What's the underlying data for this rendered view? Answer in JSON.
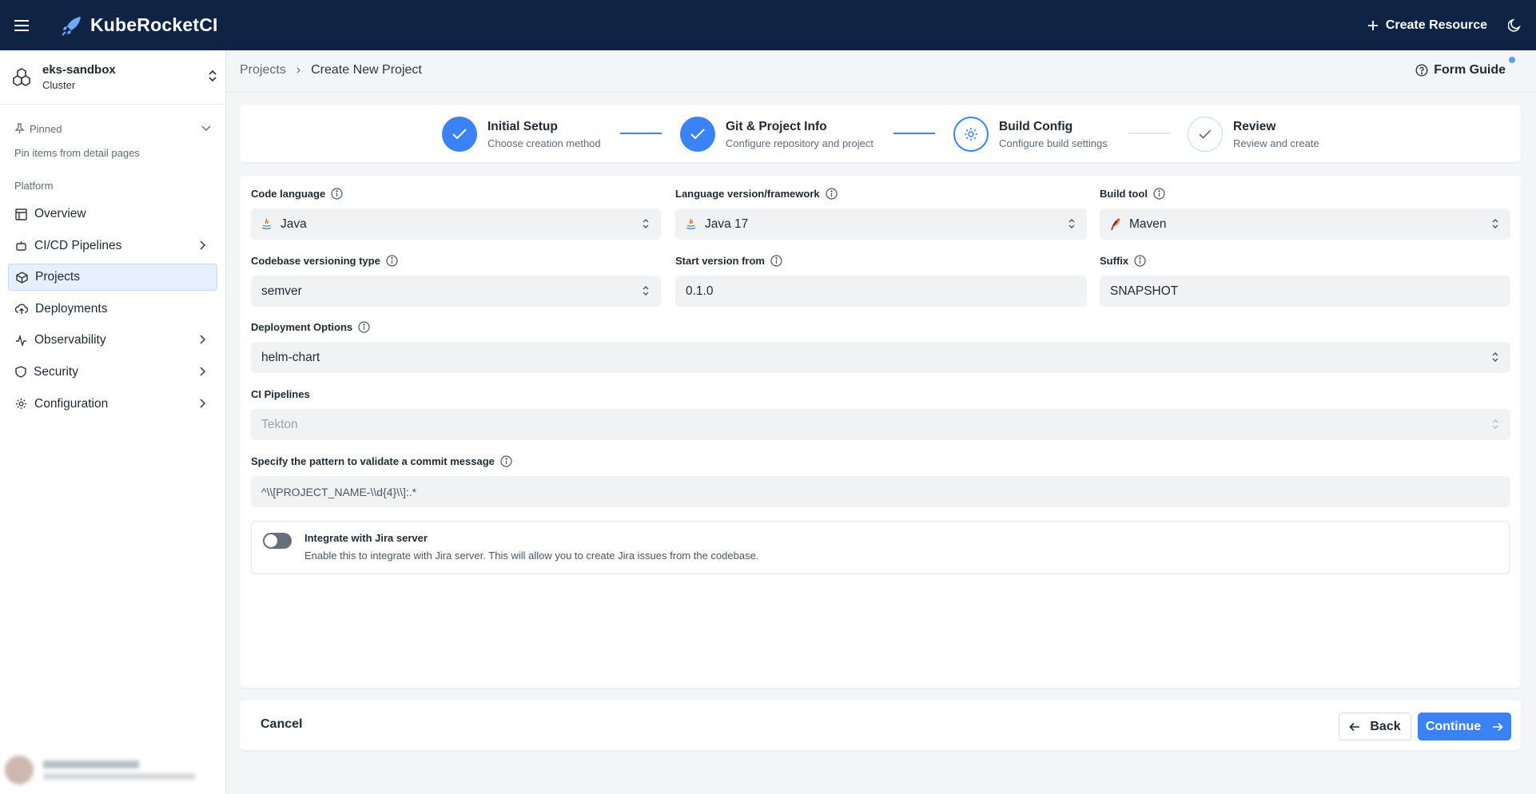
{
  "app": {
    "title": "KubeRocketCI",
    "create_resource": "Create Resource"
  },
  "cluster": {
    "name": "eks-sandbox",
    "type": "Cluster"
  },
  "sidebar": {
    "pinned_label": "Pinned",
    "pinned_hint": "Pin items from detail pages",
    "section_label": "Platform",
    "items": [
      {
        "label": "Overview",
        "icon": "table-icon"
      },
      {
        "label": "CI/CD Pipelines",
        "icon": "robot-icon"
      },
      {
        "label": "Projects",
        "icon": "box-icon",
        "active": true
      },
      {
        "label": "Deployments",
        "icon": "cloud-upload-icon"
      },
      {
        "label": "Observability",
        "icon": "activity-icon"
      },
      {
        "label": "Security",
        "icon": "shield-icon"
      },
      {
        "label": "Configuration",
        "icon": "gear-icon"
      }
    ]
  },
  "breadcrumb": {
    "parent": "Projects",
    "separator": "›",
    "current": "Create New Project"
  },
  "form_guide": "Form Guide",
  "stepper": [
    {
      "title": "Initial Setup",
      "desc": "Choose creation method",
      "state": "done"
    },
    {
      "title": "Git & Project Info",
      "desc": "Configure repository and project",
      "state": "done"
    },
    {
      "title": "Build Config",
      "desc": "Configure build settings",
      "state": "current"
    },
    {
      "title": "Review",
      "desc": "Review and create",
      "state": "todo"
    }
  ],
  "form": {
    "code_language": {
      "label": "Code language",
      "value": "Java"
    },
    "language_version": {
      "label": "Language version/framework",
      "value": "Java 17"
    },
    "build_tool": {
      "label": "Build tool",
      "value": "Maven"
    },
    "versioning_type": {
      "label": "Codebase versioning type",
      "value": "semver"
    },
    "start_version": {
      "label": "Start version from",
      "value": "0.1.0"
    },
    "suffix": {
      "label": "Suffix",
      "value": "SNAPSHOT"
    },
    "deployment_options": {
      "label": "Deployment Options",
      "value": "helm-chart"
    },
    "ci_pipelines": {
      "label": "CI Pipelines",
      "value": "Tekton"
    },
    "commit_pattern": {
      "label": "Specify the pattern to validate a commit message",
      "value": "^\\\\[PROJECT_NAME-\\\\d{4}\\\\]:.*"
    },
    "jira": {
      "label": "Integrate with Jira server",
      "desc": "Enable this to integrate with Jira server. This will allow you to create Jira issues from the codebase.",
      "enabled": false
    }
  },
  "footer": {
    "cancel": "Cancel",
    "back": "Back",
    "continue": "Continue"
  },
  "colors": {
    "topbar": "#0f2444",
    "accent": "#3b82f6",
    "active_nav": "#e5efff"
  }
}
